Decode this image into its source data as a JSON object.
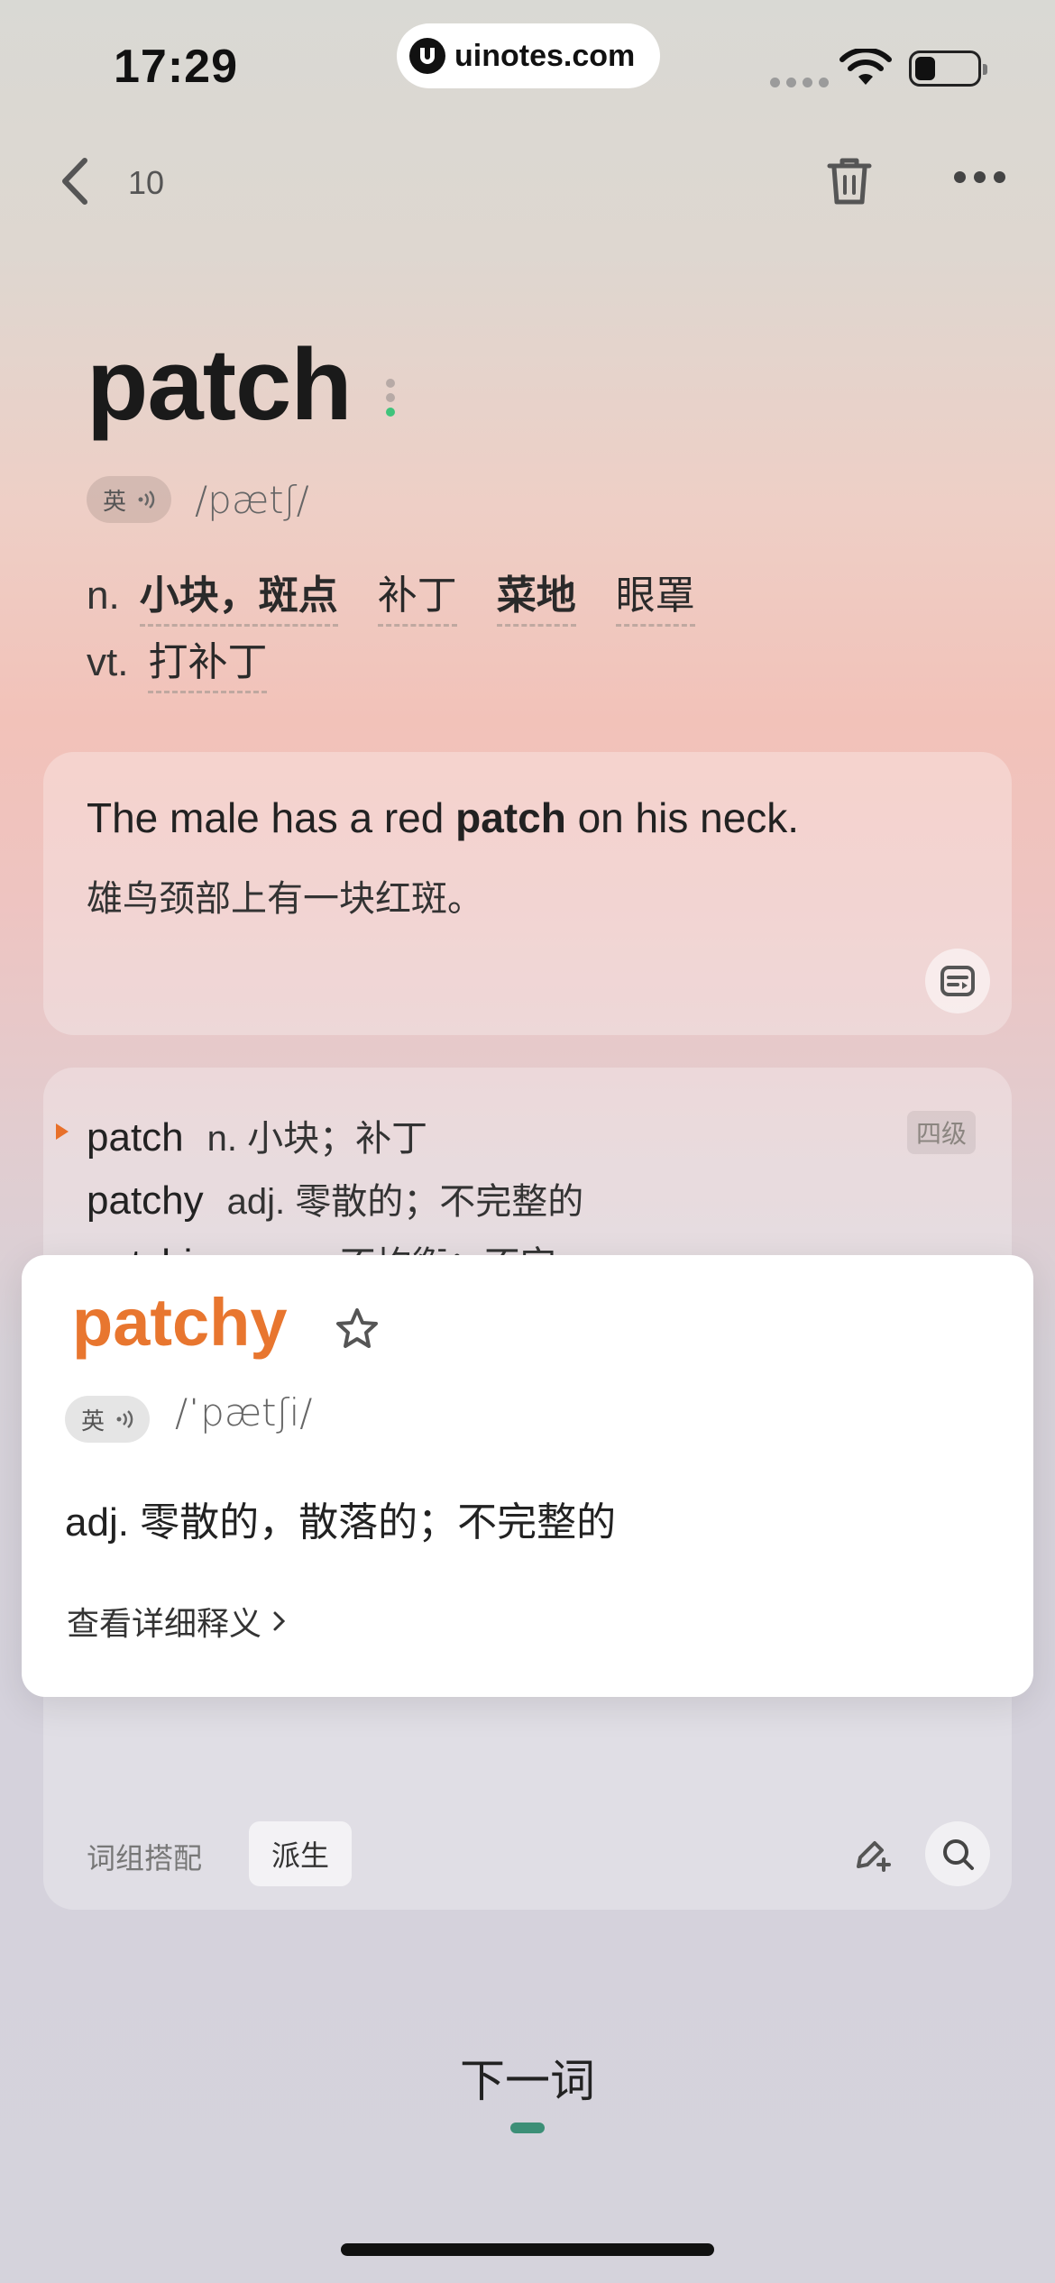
{
  "status": {
    "time": "17:29",
    "url": "uinotes.com"
  },
  "nav": {
    "count": "10"
  },
  "entry": {
    "word": "patch",
    "accent": "英",
    "phonetic": "/pætʃ/",
    "definitions": [
      {
        "pos": "n.",
        "meanings": [
          "小块，斑点",
          "补丁",
          "菜地",
          "眼罩"
        ]
      },
      {
        "pos": "vt.",
        "meanings": [
          "打补丁"
        ]
      }
    ]
  },
  "example": {
    "en_before": "The male has a red ",
    "en_bold": "patch",
    "en_after": " on his neck.",
    "zh": "雄鸟颈部上有一块红斑。"
  },
  "derivatives": {
    "items": [
      {
        "word": "patch",
        "meaning": "n. 小块；补丁"
      },
      {
        "word": "patchy",
        "meaning": "adj. 零散的；不完整的"
      },
      {
        "word": "patchiness",
        "meaning": "n. 不均衡；不完"
      }
    ],
    "level_badge": "四级"
  },
  "popup": {
    "word": "patchy",
    "accent": "英",
    "phonetic": "/ˈpætʃi/",
    "definition": "adj. 零散的，散落的；不完整的",
    "detail_link": "查看详细释义"
  },
  "tabs": {
    "collocations": "词组搭配",
    "derived": "派生"
  },
  "footer": {
    "next_label": "下一词"
  },
  "colors": {
    "accent_orange": "#e8762f",
    "progress_green": "#3c8f77"
  },
  "icons": [
    "back-icon",
    "trash-icon",
    "more-icon",
    "speaker-icon",
    "card-icon",
    "star-icon",
    "edit-icon",
    "search-icon",
    "chevron-right-icon"
  ]
}
